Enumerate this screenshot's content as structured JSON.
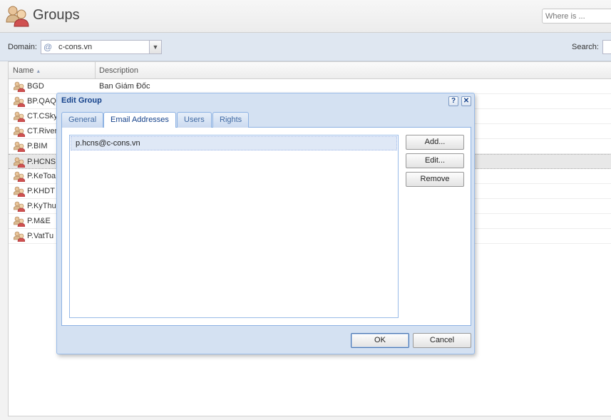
{
  "header": {
    "title": "Groups",
    "search_placeholder": "Where is ..."
  },
  "toolbar": {
    "domain_label": "Domain:",
    "domain_icon": "@",
    "domain_value": "c-cons.vn",
    "search_label": "Search:"
  },
  "grid": {
    "columns": {
      "name": "Name",
      "description": "Description"
    },
    "rows": [
      {
        "name": "BGD",
        "description": "Ban Giám Đốc"
      },
      {
        "name": "BP.QAQ",
        "description": ""
      },
      {
        "name": "CT.CSky",
        "description": ""
      },
      {
        "name": "CT.River",
        "description": ""
      },
      {
        "name": "P.BIM",
        "description": ""
      },
      {
        "name": "P.HCNS",
        "description": ""
      },
      {
        "name": "P.KeToa",
        "description": ""
      },
      {
        "name": "P.KHDT",
        "description": ""
      },
      {
        "name": "P.KyThu",
        "description": ""
      },
      {
        "name": "P.M&E",
        "description": ""
      },
      {
        "name": "P.VatTu",
        "description": ""
      }
    ],
    "selected_row": "P.HCNS"
  },
  "dialog": {
    "title": "Edit Group",
    "help": "?",
    "close": "✕",
    "tabs": [
      "General",
      "Email Addresses",
      "Users",
      "Rights"
    ],
    "active_tab": "Email Addresses",
    "addresses": [
      "p.hcns@c-cons.vn"
    ],
    "buttons": {
      "add": "Add...",
      "edit": "Edit...",
      "remove": "Remove",
      "ok": "OK",
      "cancel": "Cancel"
    }
  },
  "colors": {
    "dialog_bg": "#d4e1f2",
    "dialog_title": "#15428b",
    "selected_item": "#dfe8f6"
  }
}
